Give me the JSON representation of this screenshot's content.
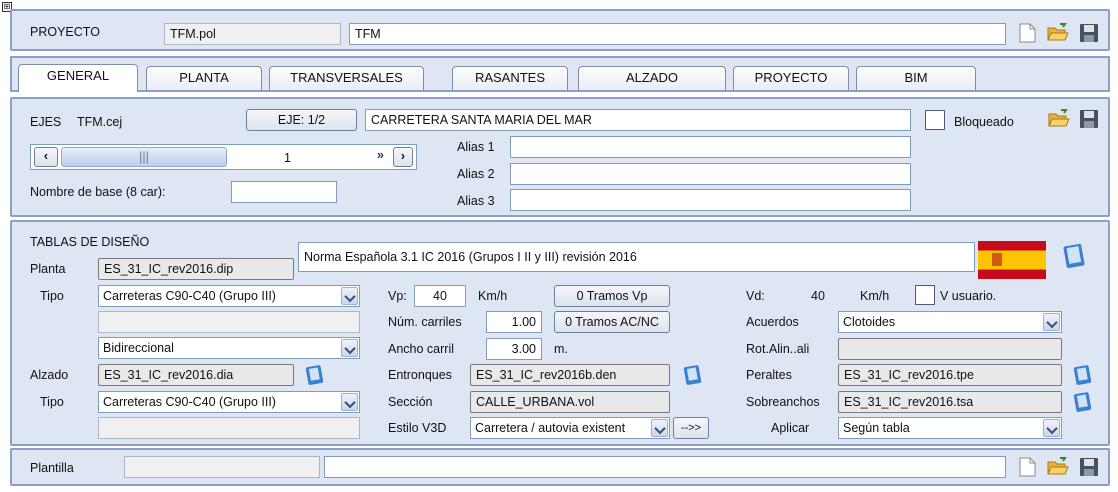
{
  "pin_glyph": "⊞",
  "project": {
    "label": "PROYECTO",
    "file": "TFM.pol",
    "name": "TFM"
  },
  "tabs": [
    "GENERAL",
    "PLANTA",
    "TRANSVERSALES",
    "RASANTES",
    "ALZADO",
    "PROYECTO",
    "BIM"
  ],
  "ejes": {
    "label": "EJES",
    "file": "TFM.cej",
    "eje_button": "EJE: 1/2",
    "name": "CARRETERA SANTA MARIA DEL MAR",
    "blocked_label": "Bloqueado",
    "blocked": false,
    "scroll_value": "1",
    "alias1_label": "Alias 1",
    "alias2_label": "Alias 2",
    "alias3_label": "Alias 3",
    "alias1": "",
    "alias2": "",
    "alias3": "",
    "base_label": "Nombre de base (8 car):",
    "base_value": ""
  },
  "tablas": {
    "title": "TABLAS DE DISEÑO",
    "planta_label": "Planta",
    "planta_file": "ES_31_IC_rev2016.dip",
    "norma": "Norma Española 3.1 IC 2016 (Grupos I II y III) revisión 2016",
    "tipo_label": "Tipo",
    "tipo1": "Carreteras C90-C40 (Grupo III)",
    "blank1": "",
    "direccion": "Bidireccional",
    "alzado_label": "Alzado",
    "alzado_file": "ES_31_IC_rev2016.dia",
    "tipo2": "Carreteras C90-C40 (Grupo III)",
    "blank2": "",
    "vp_label": "Vp:",
    "vp": "40",
    "vp_unit": "Km/h",
    "tramos_vp": "0 Tramos Vp",
    "carriles_label": "Núm. carriles",
    "carriles": "1.00",
    "tramos_ac": "0 Tramos AC/NC",
    "ancho_label": "Ancho carril",
    "ancho": "3.00",
    "ancho_unit": "m.",
    "entronques_label": "Entronques",
    "entronques": "ES_31_IC_rev2016b.den",
    "seccion_label": "Sección",
    "seccion": "CALLE_URBANA.vol",
    "estilo_label": "Estilo V3D",
    "estilo": "Carretera / autovia existent",
    "estilo_btn": "-->>",
    "vd_label": "Vd:",
    "vd": "40",
    "vd_unit": "Km/h",
    "vusuario_label": "V usuario.",
    "acuerdos_label": "Acuerdos",
    "acuerdos": "Clotoides",
    "rot_label": "Rot.Alin..ali",
    "rot": "",
    "peraltes_label": "Peraltes",
    "peraltes": "ES_31_IC_rev2016.tpe",
    "sobreanchos_label": "Sobreanchos",
    "sobreanchos": "ES_31_IC_rev2016.tsa",
    "aplicar_label": "Aplicar",
    "aplicar": "Según tabla"
  },
  "plantilla": {
    "label": "Plantilla",
    "file": "",
    "name": ""
  },
  "colors": {
    "panel": "#dfe6f3",
    "border": "#8aa0c8",
    "flag_red": "#c60b1e",
    "flag_yellow": "#ffc400"
  }
}
